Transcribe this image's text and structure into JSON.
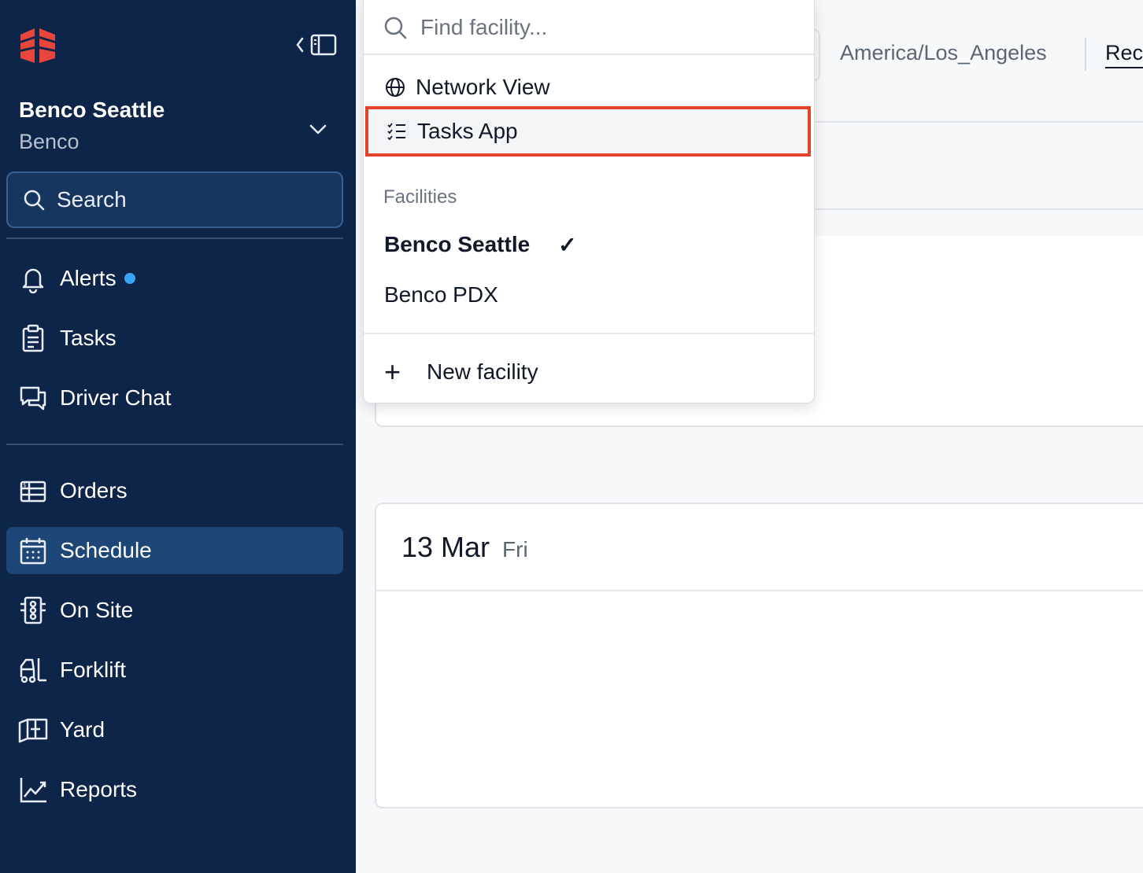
{
  "sidebar": {
    "facility": {
      "name": "Benco Seattle",
      "org": "Benco"
    },
    "search": {
      "label": "Search"
    },
    "nav_top": [
      {
        "label": "Alerts",
        "icon": "bell-icon",
        "has_dot": true
      },
      {
        "label": "Tasks",
        "icon": "clipboard-icon"
      },
      {
        "label": "Driver Chat",
        "icon": "chat-icon"
      }
    ],
    "nav_main": [
      {
        "label": "Orders",
        "icon": "orders-icon"
      },
      {
        "label": "Schedule",
        "icon": "calendar-icon",
        "active": true
      },
      {
        "label": "On Site",
        "icon": "on-site-icon"
      },
      {
        "label": "Forklift",
        "icon": "forklift-icon"
      },
      {
        "label": "Yard",
        "icon": "yard-icon"
      },
      {
        "label": "Reports",
        "icon": "chart-line-icon"
      }
    ]
  },
  "topbar": {
    "timezone": "America/Los_Angeles",
    "tab_partial": "Rec"
  },
  "schedule": {
    "date": "13 Mar",
    "weekday": "Fri"
  },
  "dropdown": {
    "search_placeholder": "Find facility...",
    "network_view": "Network View",
    "tasks_app": "Tasks App",
    "section_label": "Facilities",
    "facilities": [
      {
        "name": "Benco Seattle",
        "selected": true
      },
      {
        "name": "Benco PDX",
        "selected": false
      }
    ],
    "new_facility": "New facility"
  },
  "colors": {
    "sidebar_bg": "#0d2548",
    "active_nav": "#1e4677",
    "highlight_border": "#e0452c",
    "alert_dot": "#3ba3f5",
    "logo": "#e8453c"
  }
}
